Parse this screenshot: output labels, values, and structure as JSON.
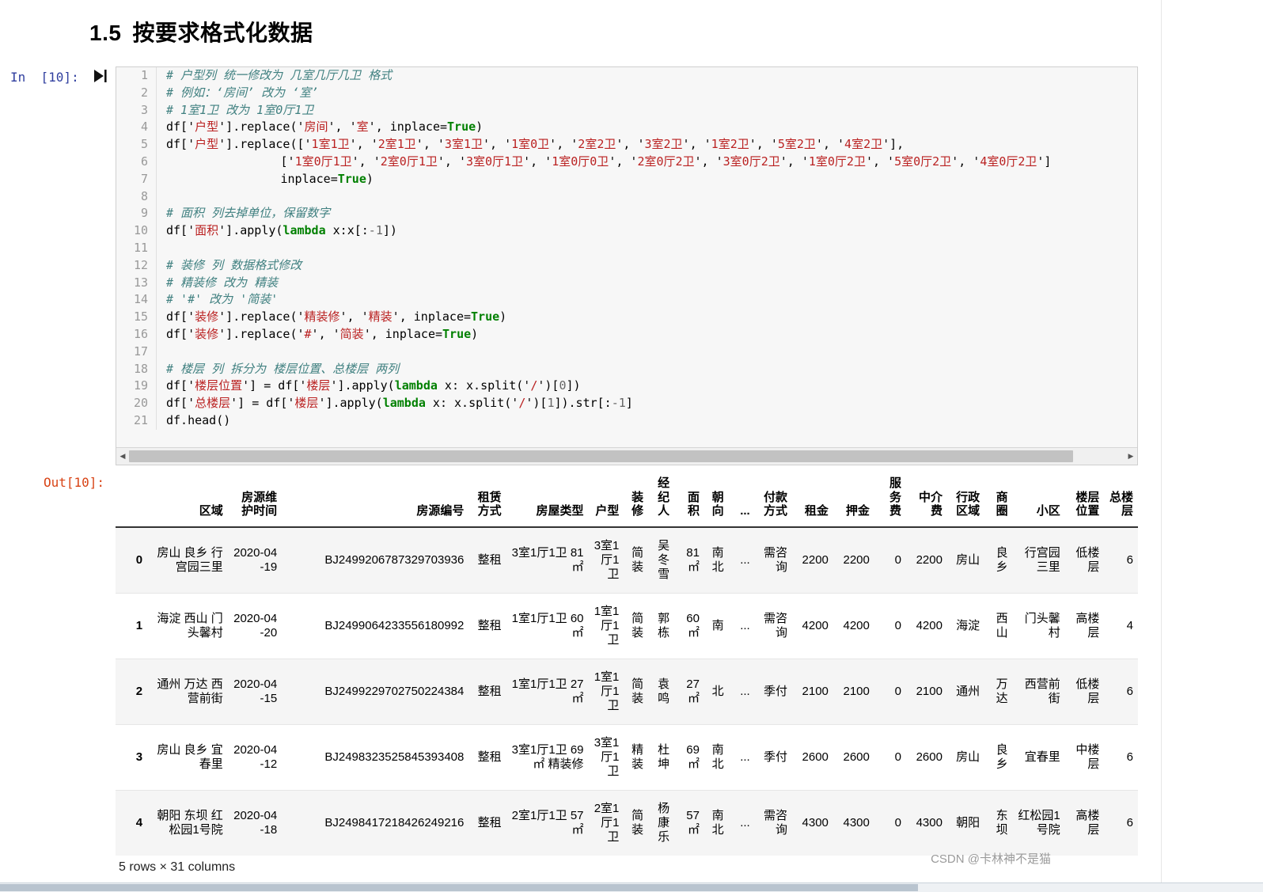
{
  "heading": {
    "number": "1.5",
    "text": "按要求格式化数据"
  },
  "prompts": {
    "input": "In  [10]:",
    "output": "Out[10]:",
    "run_icon": "run-cell-icon"
  },
  "code": {
    "lines": [
      {
        "n": "1",
        "tokens": [
          {
            "t": "cmt",
            "v": "# 户型列 统一修改为 几室几厅几卫 格式"
          }
        ]
      },
      {
        "n": "2",
        "tokens": [
          {
            "t": "cmt",
            "v": "# 例如：‘房间’ 改为 ‘室’"
          }
        ]
      },
      {
        "n": "3",
        "tokens": [
          {
            "t": "cmt",
            "v": "# 1室1卫 改为 1室0厅1卫"
          }
        ]
      },
      {
        "n": "4",
        "tokens": [
          {
            "t": "",
            "v": "df['"
          },
          {
            "t": "str",
            "v": "户型"
          },
          {
            "t": "",
            "v": "'].replace('"
          },
          {
            "t": "str",
            "v": "房间"
          },
          {
            "t": "",
            "v": "', '"
          },
          {
            "t": "str",
            "v": "室"
          },
          {
            "t": "",
            "v": "', inplace="
          },
          {
            "t": "kw",
            "v": "True"
          },
          {
            "t": "",
            "v": ")"
          }
        ]
      },
      {
        "n": "5",
        "tokens": [
          {
            "t": "",
            "v": "df['"
          },
          {
            "t": "str",
            "v": "户型"
          },
          {
            "t": "",
            "v": "'].replace(['"
          },
          {
            "t": "str",
            "v": "1室1卫"
          },
          {
            "t": "",
            "v": "', '"
          },
          {
            "t": "str",
            "v": "2室1卫"
          },
          {
            "t": "",
            "v": "', '"
          },
          {
            "t": "str",
            "v": "3室1卫"
          },
          {
            "t": "",
            "v": "', '"
          },
          {
            "t": "str",
            "v": "1室0卫"
          },
          {
            "t": "",
            "v": "', '"
          },
          {
            "t": "str",
            "v": "2室2卫"
          },
          {
            "t": "",
            "v": "', '"
          },
          {
            "t": "str",
            "v": "3室2卫"
          },
          {
            "t": "",
            "v": "', '"
          },
          {
            "t": "str",
            "v": "1室2卫"
          },
          {
            "t": "",
            "v": "', '"
          },
          {
            "t": "str",
            "v": "5室2卫"
          },
          {
            "t": "",
            "v": "', '"
          },
          {
            "t": "str",
            "v": "4室2卫"
          },
          {
            "t": "",
            "v": "'],"
          }
        ]
      },
      {
        "n": "6",
        "tokens": [
          {
            "t": "",
            "v": "                ['"
          },
          {
            "t": "str",
            "v": "1室0厅1卫"
          },
          {
            "t": "",
            "v": "', '"
          },
          {
            "t": "str",
            "v": "2室0厅1卫"
          },
          {
            "t": "",
            "v": "', '"
          },
          {
            "t": "str",
            "v": "3室0厅1卫"
          },
          {
            "t": "",
            "v": "', '"
          },
          {
            "t": "str",
            "v": "1室0厅0卫"
          },
          {
            "t": "",
            "v": "', '"
          },
          {
            "t": "str",
            "v": "2室0厅2卫"
          },
          {
            "t": "",
            "v": "', '"
          },
          {
            "t": "str",
            "v": "3室0厅2卫"
          },
          {
            "t": "",
            "v": "', '"
          },
          {
            "t": "str",
            "v": "1室0厅2卫"
          },
          {
            "t": "",
            "v": "', '"
          },
          {
            "t": "str",
            "v": "5室0厅2卫"
          },
          {
            "t": "",
            "v": "', '"
          },
          {
            "t": "str",
            "v": "4室0厅2卫"
          },
          {
            "t": "",
            "v": "']"
          }
        ]
      },
      {
        "n": "7",
        "tokens": [
          {
            "t": "",
            "v": "                inplace="
          },
          {
            "t": "kw",
            "v": "True"
          },
          {
            "t": "",
            "v": ")"
          }
        ]
      },
      {
        "n": "8",
        "tokens": [
          {
            "t": "",
            "v": ""
          }
        ]
      },
      {
        "n": "9",
        "tokens": [
          {
            "t": "cmt",
            "v": "# 面积 列去掉单位，保留数字"
          }
        ]
      },
      {
        "n": "10",
        "tokens": [
          {
            "t": "",
            "v": "df['"
          },
          {
            "t": "str",
            "v": "面积"
          },
          {
            "t": "",
            "v": "'].apply("
          },
          {
            "t": "kw",
            "v": "lambda"
          },
          {
            "t": "",
            "v": " x:x[:"
          },
          {
            "t": "num2",
            "v": "-1"
          },
          {
            "t": "",
            "v": "])"
          }
        ]
      },
      {
        "n": "11",
        "tokens": [
          {
            "t": "",
            "v": ""
          }
        ]
      },
      {
        "n": "12",
        "tokens": [
          {
            "t": "cmt",
            "v": "# 装修 列 数据格式修改"
          }
        ]
      },
      {
        "n": "13",
        "tokens": [
          {
            "t": "cmt",
            "v": "# 精装修 改为 精装"
          }
        ]
      },
      {
        "n": "14",
        "tokens": [
          {
            "t": "cmt",
            "v": "# '#' 改为 '简装'"
          }
        ]
      },
      {
        "n": "15",
        "tokens": [
          {
            "t": "",
            "v": "df['"
          },
          {
            "t": "str",
            "v": "装修"
          },
          {
            "t": "",
            "v": "'].replace('"
          },
          {
            "t": "str",
            "v": "精装修"
          },
          {
            "t": "",
            "v": "', '"
          },
          {
            "t": "str",
            "v": "精装"
          },
          {
            "t": "",
            "v": "', inplace="
          },
          {
            "t": "kw",
            "v": "True"
          },
          {
            "t": "",
            "v": ")"
          }
        ]
      },
      {
        "n": "16",
        "tokens": [
          {
            "t": "",
            "v": "df['"
          },
          {
            "t": "str",
            "v": "装修"
          },
          {
            "t": "",
            "v": "'].replace('"
          },
          {
            "t": "str",
            "v": "#"
          },
          {
            "t": "",
            "v": "', '"
          },
          {
            "t": "str",
            "v": "简装"
          },
          {
            "t": "",
            "v": "', inplace="
          },
          {
            "t": "kw",
            "v": "True"
          },
          {
            "t": "",
            "v": ")"
          }
        ]
      },
      {
        "n": "17",
        "tokens": [
          {
            "t": "",
            "v": ""
          }
        ]
      },
      {
        "n": "18",
        "tokens": [
          {
            "t": "cmt",
            "v": "# 楼层 列 拆分为 楼层位置、总楼层 两列"
          }
        ]
      },
      {
        "n": "19",
        "tokens": [
          {
            "t": "",
            "v": "df['"
          },
          {
            "t": "str",
            "v": "楼层位置"
          },
          {
            "t": "",
            "v": "'] = df['"
          },
          {
            "t": "str",
            "v": "楼层"
          },
          {
            "t": "",
            "v": "'].apply("
          },
          {
            "t": "kw",
            "v": "lambda"
          },
          {
            "t": "",
            "v": " x: x.split('"
          },
          {
            "t": "str",
            "v": "/"
          },
          {
            "t": "",
            "v": "')["
          },
          {
            "t": "num2",
            "v": "0"
          },
          {
            "t": "",
            "v": "])"
          }
        ]
      },
      {
        "n": "20",
        "tokens": [
          {
            "t": "",
            "v": "df['"
          },
          {
            "t": "str",
            "v": "总楼层"
          },
          {
            "t": "",
            "v": "'] = df['"
          },
          {
            "t": "str",
            "v": "楼层"
          },
          {
            "t": "",
            "v": "'].apply("
          },
          {
            "t": "kw",
            "v": "lambda"
          },
          {
            "t": "",
            "v": " x: x.split('"
          },
          {
            "t": "str",
            "v": "/"
          },
          {
            "t": "",
            "v": "')["
          },
          {
            "t": "num2",
            "v": "1"
          },
          {
            "t": "",
            "v": "]).str[:"
          },
          {
            "t": "num2",
            "v": "-1"
          },
          {
            "t": "",
            "v": "]"
          }
        ]
      },
      {
        "n": "21",
        "tokens": [
          {
            "t": "",
            "v": "df.head()"
          }
        ]
      }
    ],
    "scrollbar": {
      "left_arrow": "◀",
      "right_arrow": "▶"
    }
  },
  "dataframe": {
    "columns": [
      "",
      "区域",
      "房源维护时间",
      "房源编号",
      "租赁方式",
      "房屋类型",
      "户型",
      "装修",
      "经纪人",
      "面积",
      "朝向",
      "...",
      "付款方式",
      "租金",
      "押金",
      "服务费",
      "中介费",
      "行政区域",
      "商圈",
      "小区",
      "楼层位置",
      "总楼层"
    ],
    "rows": [
      [
        "0",
        "房山 良乡 行宫园三里",
        "2020-04-19",
        "BJ2499206787329703936",
        "整租",
        "3室1厅1卫 81㎡",
        "3室1厅1卫",
        "简装",
        "吴冬雪",
        "81 ㎡",
        "南北",
        "...",
        "需咨询",
        "2200",
        "2200",
        "0",
        "2200",
        "房山",
        "良乡",
        "行宫园三里",
        "低楼层",
        "6"
      ],
      [
        "1",
        "海淀 西山 门头馨村",
        "2020-04-20",
        "BJ2499064233556180992",
        "整租",
        "1室1厅1卫 60㎡",
        "1室1厅1卫",
        "简装",
        "郭栋",
        "60 ㎡",
        "南",
        "...",
        "需咨询",
        "4200",
        "4200",
        "0",
        "4200",
        "海淀",
        "西山",
        "门头馨村",
        "高楼层",
        "4"
      ],
      [
        "2",
        "通州 万达 西营前街",
        "2020-04-15",
        "BJ2499229702750224384",
        "整租",
        "1室1厅1卫 27㎡",
        "1室1厅1卫",
        "简装",
        "袁鸣",
        "27 ㎡",
        "北",
        "...",
        "季付",
        "2100",
        "2100",
        "0",
        "2100",
        "通州",
        "万达",
        "西营前街",
        "低楼层",
        "6"
      ],
      [
        "3",
        "房山 良乡 宜春里",
        "2020-04-12",
        "BJ2498323525845393408",
        "整租",
        "3室1厅1卫 69㎡ 精装修",
        "3室1厅1卫",
        "精装",
        "杜坤",
        "69 ㎡",
        "南北",
        "...",
        "季付",
        "2600",
        "2600",
        "0",
        "2600",
        "房山",
        "良乡",
        "宜春里",
        "中楼层",
        "6"
      ],
      [
        "4",
        "朝阳 东坝 红松园1号院",
        "2020-04-18",
        "BJ2498417218426249216",
        "整租",
        "2室1厅1卫 57㎡",
        "2室1厅1卫",
        "简装",
        "杨康乐",
        "57 ㎡",
        "南北",
        "...",
        "需咨询",
        "4300",
        "4300",
        "0",
        "4300",
        "朝阳",
        "东坝",
        "红松园1号院",
        "高楼层",
        "6"
      ]
    ],
    "footer": "5 rows × 31 columns"
  },
  "watermark": "CSDN @卡林神不是猫",
  "colors": {
    "comment": "#408080",
    "string": "#BA2121",
    "keyword": "#008000",
    "in_prompt": "#303F9F",
    "out_prompt": "#D84315",
    "cell_bg": "#f7f7f7",
    "cell_border": "#cfcfcf"
  }
}
